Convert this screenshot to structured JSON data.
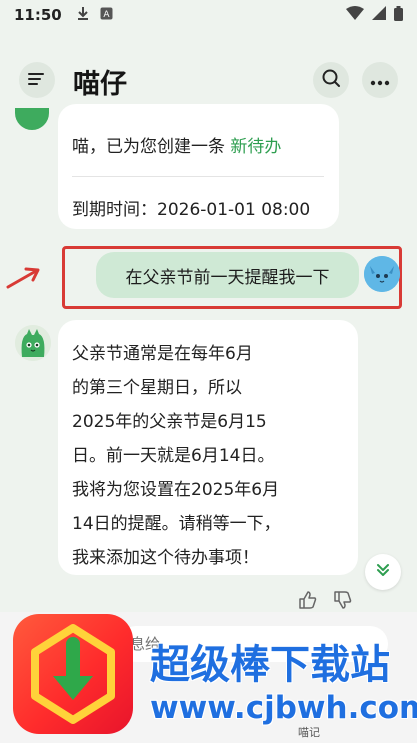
{
  "status_bar": {
    "time": "11:50",
    "icons": [
      "download-icon",
      "notification-a-icon",
      "wifi-icon",
      "signal-icon",
      "battery-icon"
    ]
  },
  "header": {
    "title": "喵仔",
    "menu_icon": "menu-icon",
    "search_icon": "search-icon",
    "more_icon": "more-icon"
  },
  "messages": {
    "todo_card": {
      "text_prefix": "喵，已为您创建一条 ",
      "link_text": "新待办",
      "due_label": "到期时间：2026-01-01 08:00"
    },
    "user_message": {
      "text": "在父亲节前一天提醒我一下"
    },
    "bot_reply": {
      "text": "父亲节通常是在每年6月\n的第三个星期日，所以\n2025年的父亲节是6月15\n日。前一天就是6月14日。\n我将为您设置在2025年6月\n14日的提醒。请稍等一下，\n我来添加这个待办事项！"
    }
  },
  "input": {
    "placeholder": "息给"
  },
  "watermark": {
    "title": "超级棒下载站",
    "url": "www.cjbwh.com"
  },
  "bottom_nav": {
    "label": "喵记"
  },
  "colors": {
    "accent_green": "#2e9e50",
    "user_bubble": "#cfe9d5",
    "highlight_red": "#d83a35",
    "watermark_blue": "#1f6fe0"
  }
}
